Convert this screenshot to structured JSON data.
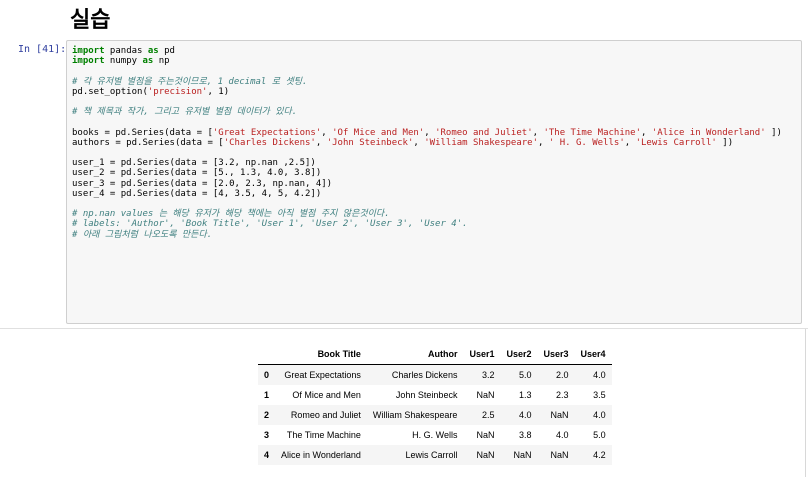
{
  "heading": "실습",
  "prompt": "In [41]:",
  "code_lines": [
    [
      {
        "t": "import",
        "c": "kw"
      },
      {
        "t": " pandas "
      },
      {
        "t": "as",
        "c": "kw"
      },
      {
        "t": " pd"
      }
    ],
    [
      {
        "t": "import",
        "c": "kw"
      },
      {
        "t": " numpy "
      },
      {
        "t": "as",
        "c": "kw"
      },
      {
        "t": " np"
      }
    ],
    [
      {
        "t": ""
      }
    ],
    [
      {
        "t": "# 각 유저별 별점을 주는것이므로, 1 decimal 로 셋팅.",
        "c": "cm"
      }
    ],
    [
      {
        "t": "pd.set_option("
      },
      {
        "t": "'precision'",
        "c": "st"
      },
      {
        "t": ", 1)"
      }
    ],
    [
      {
        "t": ""
      }
    ],
    [
      {
        "t": "# 책 제목과 작가, 그리고 유저별 별점 데이터가 있다.",
        "c": "cm"
      }
    ],
    [
      {
        "t": ""
      }
    ],
    [
      {
        "t": "books = pd.Series(data = ["
      },
      {
        "t": "'Great Expectations'",
        "c": "st"
      },
      {
        "t": ", "
      },
      {
        "t": "'Of Mice and Men'",
        "c": "st"
      },
      {
        "t": ", "
      },
      {
        "t": "'Romeo and Juliet'",
        "c": "st"
      },
      {
        "t": ", "
      },
      {
        "t": "'The Time Machine'",
        "c": "st"
      },
      {
        "t": ", "
      },
      {
        "t": "'Alice in Wonderland'",
        "c": "st"
      },
      {
        "t": " ])"
      }
    ],
    [
      {
        "t": "authors = pd.Series(data = ["
      },
      {
        "t": "'Charles Dickens'",
        "c": "st"
      },
      {
        "t": ", "
      },
      {
        "t": "'John Steinbeck'",
        "c": "st"
      },
      {
        "t": ", "
      },
      {
        "t": "'William Shakespeare'",
        "c": "st"
      },
      {
        "t": ", "
      },
      {
        "t": "' H. G. Wells'",
        "c": "st"
      },
      {
        "t": ", "
      },
      {
        "t": "'Lewis Carroll'",
        "c": "st"
      },
      {
        "t": " ])"
      }
    ],
    [
      {
        "t": ""
      }
    ],
    [
      {
        "t": "user_1 = pd.Series(data = [3.2, np.nan ,2.5])"
      }
    ],
    [
      {
        "t": "user_2 = pd.Series(data = [5., 1.3, 4.0, 3.8])"
      }
    ],
    [
      {
        "t": "user_3 = pd.Series(data = [2.0, 2.3, np.nan, 4])"
      }
    ],
    [
      {
        "t": "user_4 = pd.Series(data = [4, 3.5, 4, 5, 4.2])"
      }
    ],
    [
      {
        "t": ""
      }
    ],
    [
      {
        "t": "# np.nan values 는 해당 유저가 해당 책에는 아직 별점 주지 않은것이다.",
        "c": "cm"
      }
    ],
    [
      {
        "t": "# labels: 'Author', 'Book Title', 'User 1', 'User 2', 'User 3', 'User 4'.",
        "c": "cm"
      }
    ],
    [
      {
        "t": "# 아래 그림처럼 나오도록 만든다.",
        "c": "cm"
      }
    ]
  ],
  "table": {
    "columns": [
      "",
      "Book Title",
      "Author",
      "User1",
      "User2",
      "User3",
      "User4"
    ],
    "rows": [
      [
        "0",
        "Great Expectations",
        "Charles Dickens",
        "3.2",
        "5.0",
        "2.0",
        "4.0"
      ],
      [
        "1",
        "Of Mice and Men",
        "John Steinbeck",
        "NaN",
        "1.3",
        "2.3",
        "3.5"
      ],
      [
        "2",
        "Romeo and Juliet",
        "William Shakespeare",
        "2.5",
        "4.0",
        "NaN",
        "4.0"
      ],
      [
        "3",
        "The Time Machine",
        "H. G. Wells",
        "NaN",
        "3.8",
        "4.0",
        "5.0"
      ],
      [
        "4",
        "Alice in Wonderland",
        "Lewis Carroll",
        "NaN",
        "NaN",
        "NaN",
        "4.2"
      ]
    ]
  }
}
